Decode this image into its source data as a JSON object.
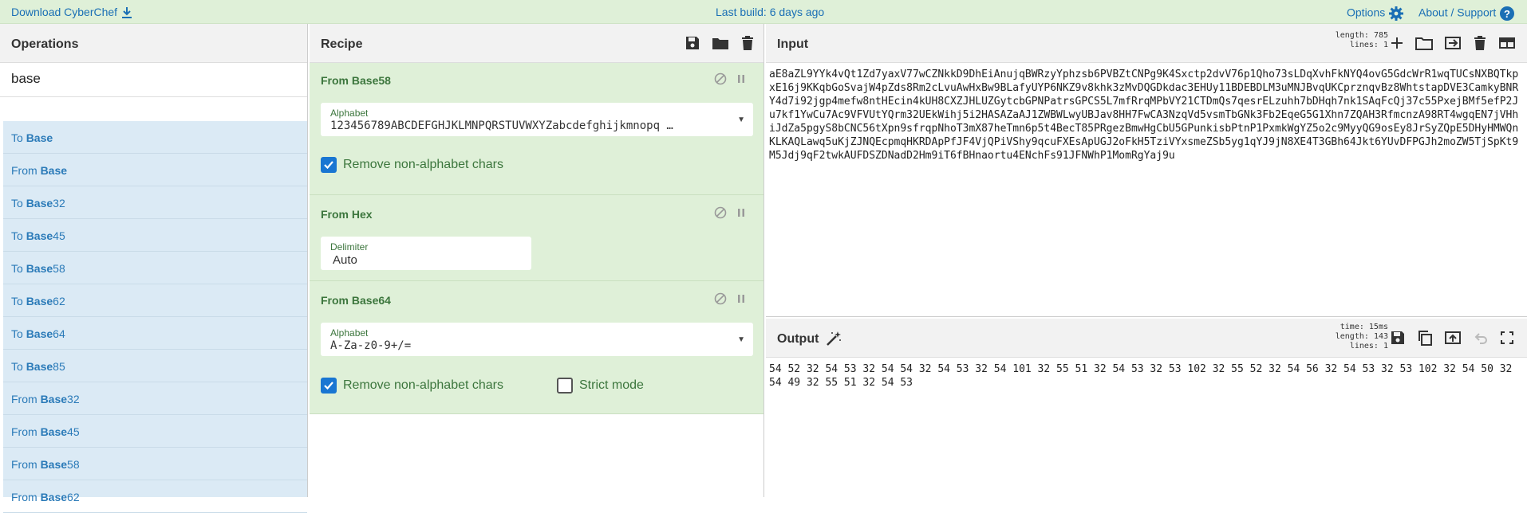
{
  "topbar": {
    "download_label": "Download CyberChef",
    "build_label": "Last build: 6 days ago",
    "options_label": "Options",
    "about_label": "About / Support"
  },
  "operations": {
    "title": "Operations",
    "search_value": "base",
    "items": [
      {
        "pre": "To ",
        "match": "Base",
        "post": ""
      },
      {
        "pre": "From ",
        "match": "Base",
        "post": ""
      },
      {
        "pre": "To ",
        "match": "Base",
        "post": "32"
      },
      {
        "pre": "To ",
        "match": "Base",
        "post": "45"
      },
      {
        "pre": "To ",
        "match": "Base",
        "post": "58"
      },
      {
        "pre": "To ",
        "match": "Base",
        "post": "62"
      },
      {
        "pre": "To ",
        "match": "Base",
        "post": "64"
      },
      {
        "pre": "To ",
        "match": "Base",
        "post": "85"
      },
      {
        "pre": "From ",
        "match": "Base",
        "post": "32"
      },
      {
        "pre": "From ",
        "match": "Base",
        "post": "45"
      },
      {
        "pre": "From ",
        "match": "Base",
        "post": "58"
      },
      {
        "pre": "From ",
        "match": "Base",
        "post": "62"
      }
    ]
  },
  "recipe": {
    "title": "Recipe",
    "cards": [
      {
        "title": "From Base58",
        "alphabet_label": "Alphabet",
        "alphabet_value": "123456789ABCDEFGHJKLMNPQRSTUVWXYZabcdefghijkmnopq …",
        "checkbox_label": "Remove non-alphabet chars"
      },
      {
        "title": "From Hex",
        "delimiter_label": "Delimiter",
        "delimiter_value": "Auto"
      },
      {
        "title": "From Base64",
        "alphabet_label": "Alphabet",
        "alphabet_value": "A-Za-z0-9+/=",
        "checkbox_label": "Remove non-alphabet chars",
        "strict_label": "Strict mode"
      }
    ]
  },
  "input": {
    "title": "Input",
    "length_label": "length:",
    "length_value": "785",
    "lines_label": "lines:",
    "lines_value": "1",
    "text": "aE8aZL9YYk4vQt1Zd7yaxV77wCZNkkD9DhEiAnujqBWRzyYphzsb6PVBZtCNPg9K4Sxctp2dvV76p1Qho73sLDqXvhFkNYQ4ovG5GdcWrR1wqTUCsNXBQTkpxE16j9KKqbGoSvajW4pZds8Rm2cLvuAwHxBw9BLafyUYP6NKZ9v8khk3zMvDQGDkdac3EHUy11BDEBDLM3uMNJBvqUKCprznqvBz8WhtstapDVE3CamkyBNRY4d7i92jgp4mefw8ntHEcin4kUH8CXZJHLUZGytcbGPNPatrsGPCS5L7mfRrqMPbVY21CTDmQs7qesrELzuhh7bDHqh7nk1SAqFcQj37c55PxejBMf5efP2Ju7kf1YwCu7Ac9VFVUtYQrm32UEkWihj5i2HASAZaAJ1ZWBWLwyUBJav8HH7FwCA3NzqVd5vsmTbGNk3Fb2EqeG5G1Xhn7ZQAH3RfmcnzA98RT4wgqEN7jVHhiJdZa5pgyS8bCNC56tXpn9sfrqpNhoT3mX87heTmn6p5t4BecT85PRgezBmwHgCbU5GPunkisbPtnP1PxmkWgYZ5o2c9MyyQG9osEy8JrSyZQpE5DHyHMWQnKLKAQLawq5uKjZJNQEcpmqHKRDApPfJF4VjQPiVShy9qcuFXEsApUGJ2oFkH5TziVYxsmeZSb5yg1qYJ9jN8XE4T3GBh64Jkt6YUvDFPGJh2moZW5TjSpKt9M5Jdj9qF2twkAUFDSZDNadD2Hm9iT6fBHnaortu4ENchFs91JFNWhP1MomRgYaj9u"
  },
  "output": {
    "title": "Output",
    "time_label": "time:",
    "time_value": "15ms",
    "length_label": "length:",
    "length_value": "143",
    "lines_label": "lines:",
    "lines_value": "1",
    "text": "54 52 32 54 53 32 54 54 32 54 53 32 54 101 32 55 51 32 54 53 32 53 102 32 55 52 32 54 56 32 54 53 32 53 102 32 54 50 32 54 49 32 55 51 32 54 53"
  },
  "colors": {
    "topbar_bg": "#dff0d8",
    "link": "#1a6fb5",
    "card_bg": "#dff0d8",
    "card_text": "#3c763d",
    "oplist_bg": "#dbeaf5",
    "checkbox_on": "#1976d2"
  }
}
